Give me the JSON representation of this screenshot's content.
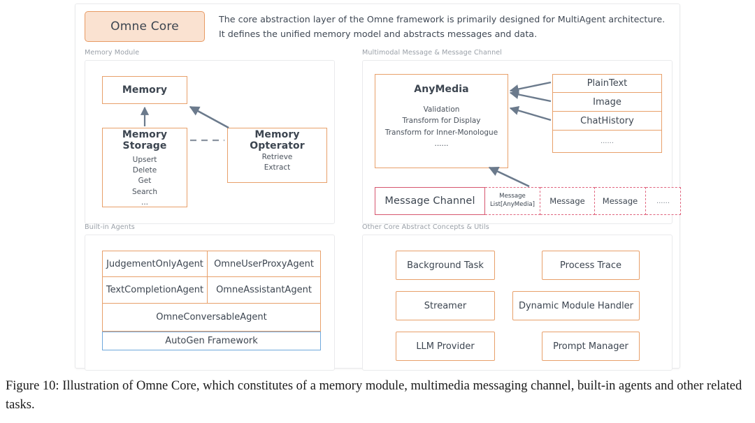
{
  "header": {
    "chip_label": "Omne Core",
    "description": "The core abstraction layer of the Omne framework is primarily designed for MultiAgent architecture. It defines the unified memory model and abstracts messages and data."
  },
  "colors": {
    "chip_fill": "#fae2d1",
    "orange_border": "#e8a06a",
    "blue_border": "#6fa8dc",
    "pink_border": "#d6566f",
    "pink_dashed": "#e0647e",
    "arrow": "#6b7a8c",
    "panel_border": "#e9eaec",
    "label_text": "#9aa0a8",
    "body_text": "#3c4550"
  },
  "panels": {
    "memory": {
      "label": "Memory Module",
      "memory_box": "Memory",
      "memory_storage": {
        "title": "Memory Storage",
        "items": "Upsert\nDelete\nGet\nSearch\n..."
      },
      "memory_operator": {
        "title": "Memory Opterator",
        "items": "Retrieve\nExtract"
      }
    },
    "multimodal": {
      "label": "Multimodal Message & Message Channel",
      "anymedia": {
        "title": "AnyMedia",
        "items": "Validation\nTransform for Display\nTransform for Inner-Monologue\n......"
      },
      "media_types": [
        "PlainText",
        "Image",
        "ChatHistory",
        "......"
      ],
      "channel": {
        "title": "Message Channel",
        "cells": [
          "Message\nList[AnyMedia]",
          "Message",
          "Message",
          "......"
        ]
      }
    },
    "agents": {
      "label": "Built-in Agents",
      "row1": [
        "JudgementOnlyAgent",
        "OmneUserProxyAgent"
      ],
      "row2": [
        "TextCompletionAgent",
        "OmneAssistantAgent"
      ],
      "row3": "OmneConversableAgent",
      "row4": "AutoGen Framework"
    },
    "other": {
      "label": "Other Core Abstract Concepts & Utils",
      "left_items": [
        "Background Task",
        "Streamer",
        "LLM Provider"
      ],
      "right_items": [
        "Process Trace",
        "Dynamic Module Handler",
        "Prompt Manager"
      ]
    }
  },
  "caption": "Figure 10: Illustration of Omne Core, which constitutes of a memory module, multimedia messaging channel, built-in agents and other related tasks."
}
